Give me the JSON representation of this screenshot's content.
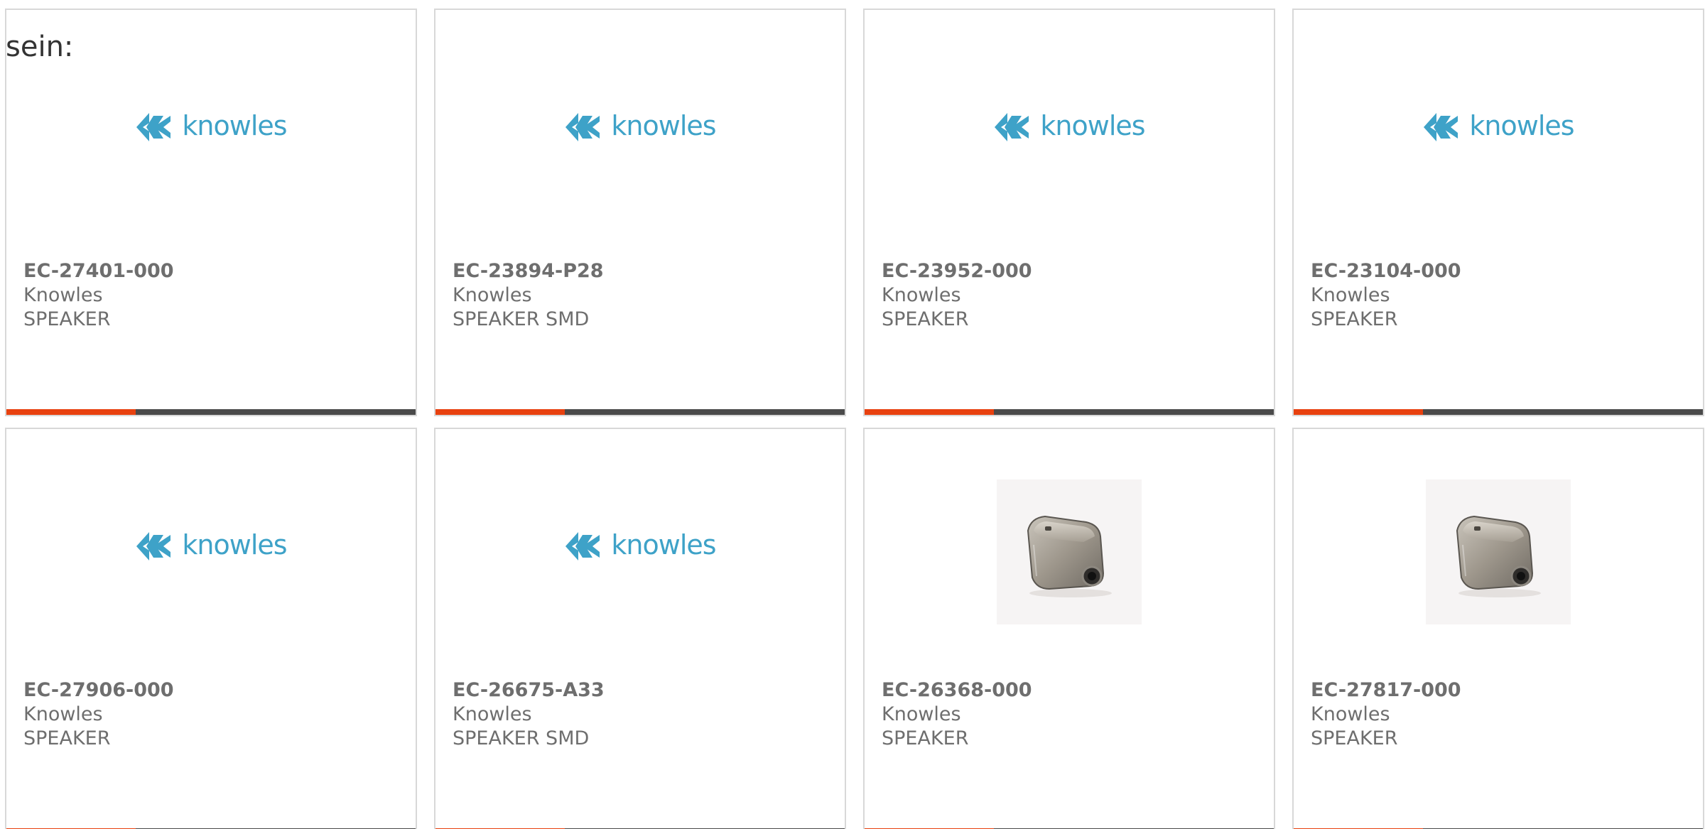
{
  "overlay_text": "sein:",
  "colors": {
    "card_border": "#d8d8d8",
    "text": "#6e6e6e",
    "brand_blue": "#3ea2c8",
    "bar_accent": "#e8410f",
    "bar_dark": "#4a4a4a"
  },
  "products": [
    {
      "part_number": "EC-27401-000",
      "manufacturer": "Knowles",
      "category": "SPEAKER",
      "image": "knowles-logo"
    },
    {
      "part_number": "EC-23894-P28",
      "manufacturer": "Knowles",
      "category": "SPEAKER SMD",
      "image": "knowles-logo"
    },
    {
      "part_number": "EC-23952-000",
      "manufacturer": "Knowles",
      "category": "SPEAKER",
      "image": "knowles-logo"
    },
    {
      "part_number": "EC-23104-000",
      "manufacturer": "Knowles",
      "category": "SPEAKER",
      "image": "knowles-logo"
    },
    {
      "part_number": "EC-27906-000",
      "manufacturer": "Knowles",
      "category": "SPEAKER",
      "image": "knowles-logo"
    },
    {
      "part_number": "EC-26675-A33",
      "manufacturer": "Knowles",
      "category": "SPEAKER SMD",
      "image": "knowles-logo"
    },
    {
      "part_number": "EC-26368-000",
      "manufacturer": "Knowles",
      "category": "SPEAKER",
      "image": "speaker-photo"
    },
    {
      "part_number": "EC-27817-000",
      "manufacturer": "Knowles",
      "category": "SPEAKER",
      "image": "speaker-photo"
    }
  ],
  "brand_logo_text": "knowles"
}
